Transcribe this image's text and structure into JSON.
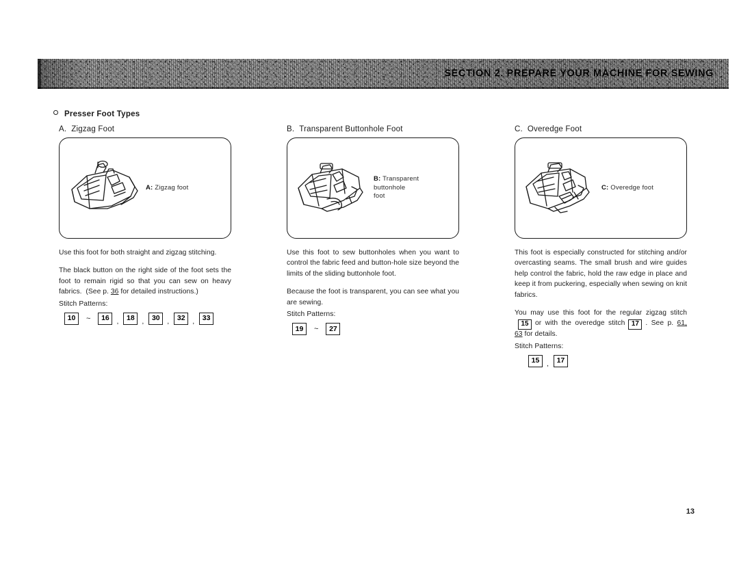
{
  "banner": {
    "title": "SECTION 2.   PREPARE YOUR MACHINE FOR SEWING",
    "background_color": "#cfcfcf",
    "text_color": "#000000"
  },
  "section_heading": "Presser Foot Types",
  "page_number": "13",
  "columns": [
    {
      "id": "a",
      "heading_letter": "A.",
      "heading_label": "Zigzag Foot",
      "illustration": {
        "icon": "zigzag-presser-foot-illustration",
        "caption_letter": "A:",
        "caption_lines": [
          "Zigzag foot"
        ]
      },
      "paragraphs": [
        "Use this foot for both straight and zigzag stitching.",
        "The black button on the right side of the foot sets the foot to remain rigid so that you can sew on heavy fabrics.  (See p. 36 for detailed instructions.)"
      ],
      "paragraph_page_ref": "36",
      "stitch_label": "Stitch Patterns:",
      "stitch_patterns": [
        "10",
        "~",
        "16",
        ",",
        "18",
        ",",
        "30",
        ",",
        "32",
        ",",
        "33"
      ]
    },
    {
      "id": "b",
      "heading_letter": "B.",
      "heading_label": "Transparent Buttonhole Foot",
      "illustration": {
        "icon": "transparent-buttonhole-presser-foot-illustration",
        "caption_letter": "B:",
        "caption_lines": [
          "Transparent",
          "buttonhole",
          "foot"
        ]
      },
      "paragraphs": [
        "Use this foot to sew buttonholes when you want to control the fabric feed and button-hole size beyond the limits of the sliding buttonhole foot.",
        "Because the foot is transparent, you can see what you are sewing."
      ],
      "stitch_label": "Stitch Patterns:",
      "stitch_patterns": [
        "19",
        "~",
        "27"
      ]
    },
    {
      "id": "c",
      "heading_letter": "C.",
      "heading_label": "Overedge Foot",
      "illustration": {
        "icon": "overedge-presser-foot-illustration",
        "caption_letter": "C:",
        "caption_lines": [
          "Overedge foot"
        ]
      },
      "paragraphs": [
        "This foot is especially constructed for stitching and/or overcasting seams.  The small brush and wire guides help control the fabric, hold the raw edge in place and keep it from puckering, especially when sewing on knit fabrics."
      ],
      "usage_paragraph": {
        "part1": "You may use this foot for the regular zigzag stitch",
        "stitch1": "15",
        "part2": "or with the overedge stitch",
        "stitch2": "17",
        "part3": ". See p.",
        "page_ref": "61, 63",
        "part4": "for details."
      },
      "stitch_label": "Stitch Patterns:",
      "stitch_patterns": [
        "15",
        ",",
        "17"
      ]
    }
  ]
}
